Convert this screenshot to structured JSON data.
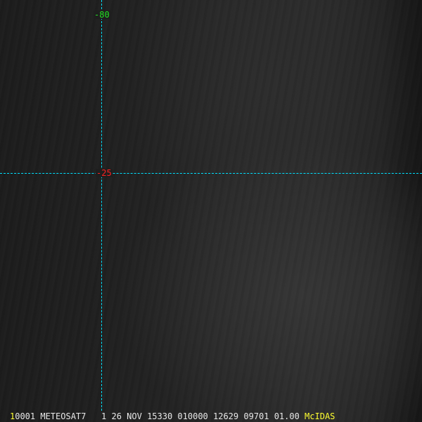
{
  "grid": {
    "longitude_label": "-80",
    "latitude_label": "-25",
    "line_color": "#00e0ff"
  },
  "footer": {
    "frame": "1",
    "text": "0001 METEOSAT7   1 26 NOV 15330 010000 12629 09701 01.00",
    "brand": "McIDAS"
  }
}
